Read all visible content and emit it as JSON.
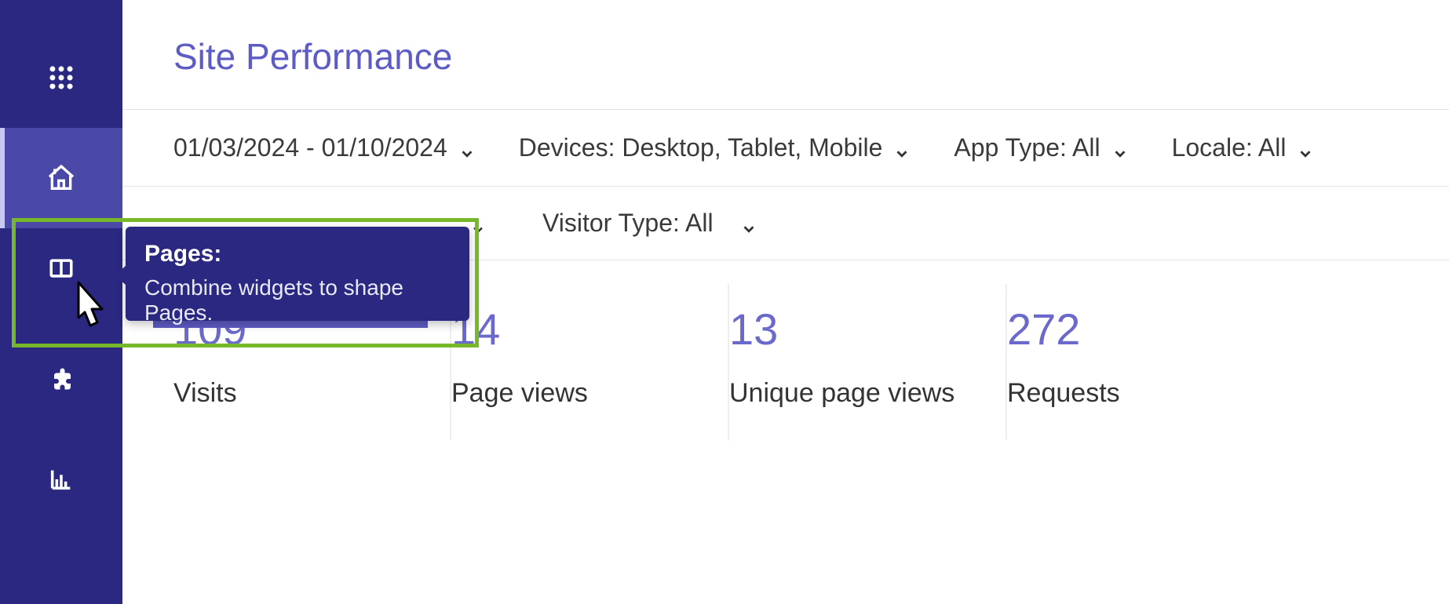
{
  "page_title": "Site Performance",
  "filters_row1": {
    "date_range": "01/03/2024 - 01/10/2024",
    "devices": "Devices: Desktop, Tablet, Mobile",
    "app_type": "App Type: All",
    "locale": "Locale: All"
  },
  "filters_row2": {
    "visitor_type": "Visitor Type: All"
  },
  "tooltip": {
    "title": "Pages:",
    "description": "Combine widgets to shape Pages."
  },
  "metrics": [
    {
      "value": "109",
      "label": "Visits"
    },
    {
      "value": "14",
      "label": "Page views"
    },
    {
      "value": "13",
      "label": "Unique page views"
    },
    {
      "value": "272",
      "label": "Requests"
    }
  ],
  "sidebar_icons": [
    "apps",
    "home",
    "pages",
    "plugin",
    "chart"
  ]
}
